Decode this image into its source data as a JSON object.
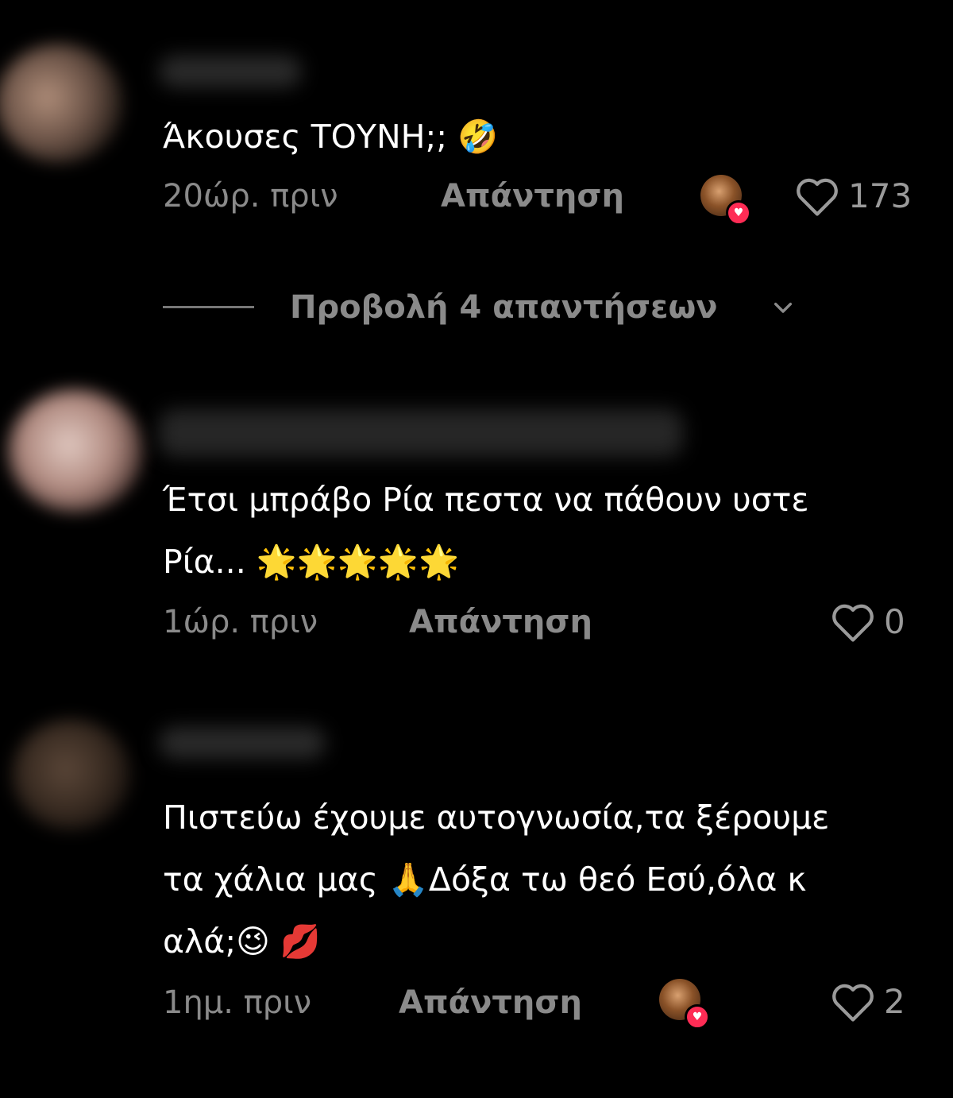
{
  "comments": [
    {
      "text": "Άκουσες ΤΟΥΝΗ;; 🤣",
      "time": "20ώρ. πριν",
      "reply_label": "Απάντηση",
      "creator_liked": true,
      "likes": "173"
    },
    {
      "text": "Έτσι μπράβο Ρία πεστα να πάθουν υστε\nΡία... 🌟🌟🌟🌟🌟",
      "time": "1ώρ. πριν",
      "reply_label": "Απάντηση",
      "creator_liked": false,
      "likes": "0"
    },
    {
      "text": "Πιστεύω έχουμε αυτογνωσία,τα ξέρουμε\nτα χάλια μας 🙏Δόξα τω θεό Εσύ,όλα κ\nαλά;😉 💋",
      "time": "1ημ. πριν",
      "reply_label": "Απάντηση",
      "creator_liked": true,
      "likes": "2"
    }
  ],
  "view_replies": {
    "label": "Προβολή 4 απαντήσεων"
  },
  "icons": {
    "heart": "heart-outline-icon",
    "chevron": "chevron-down-icon",
    "badge": "heart-badge-icon"
  },
  "colors": {
    "background": "#000000",
    "text": "#ffffff",
    "muted": "#8a8a8a",
    "badge": "#fe2c55"
  }
}
